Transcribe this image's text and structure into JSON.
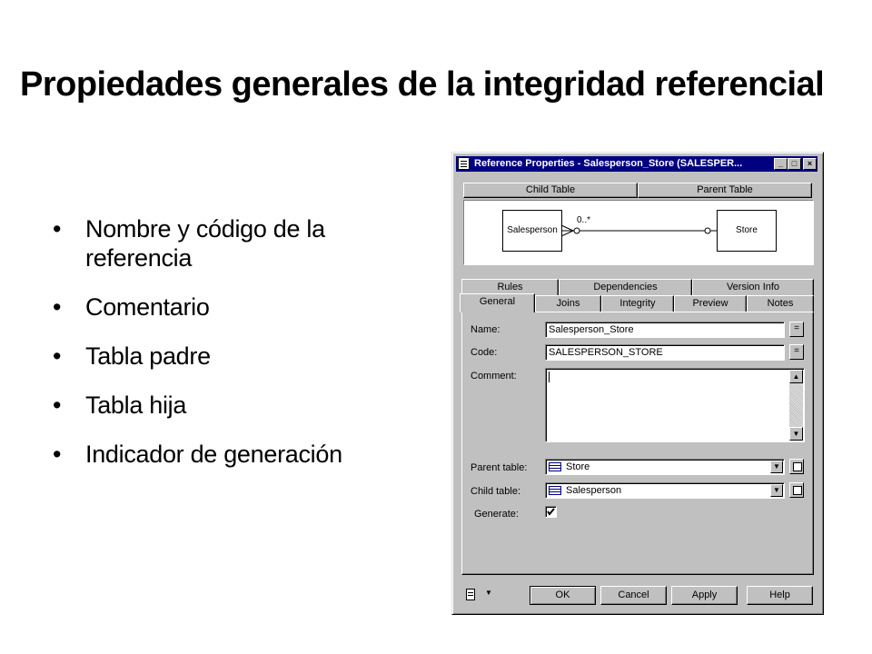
{
  "slide": {
    "title": "Propiedades generales de la integridad referencial",
    "bullets": [
      {
        "line1": "Nombre y código de la",
        "line2": "referencia"
      },
      {
        "line1": "Comentario",
        "line2": ""
      },
      {
        "line1": "Tabla padre",
        "line2": ""
      },
      {
        "line1": "Tabla hija",
        "line2": ""
      },
      {
        "line1": "Indicador de generación",
        "line2": ""
      }
    ],
    "bullet_glyph": "•"
  },
  "dialog": {
    "title": "Reference Properties - Salesperson_Store (SALESPER...",
    "title_buttons": [
      "_",
      "□",
      "×"
    ],
    "header_buttons": {
      "child_table": "Child Table",
      "parent_table": "Parent Table"
    },
    "diagram": {
      "child_entity": "Salesperson",
      "parent_entity": "Store",
      "cardinality": "0..*"
    },
    "tabs_back": [
      "Rules",
      "Dependencies",
      "Version Info"
    ],
    "tabs_front": [
      "General",
      "Joins",
      "Integrity",
      "Preview",
      "Notes"
    ],
    "active_tab": "General",
    "form": {
      "name_label": "Name:",
      "name_value": "Salesperson_Store",
      "code_label": "Code:",
      "code_value": "SALESPERSON_STORE",
      "equals_glyph": "=",
      "comment_label": "Comment:",
      "comment_value": "",
      "parent_table_label": "Parent table:",
      "parent_table_value": "Store",
      "child_table_label": "Child table:",
      "child_table_value": "Salesperson",
      "generate_label": "Generate:",
      "generate_checked": true
    },
    "footer": {
      "ok": "OK",
      "cancel": "Cancel",
      "apply": "Apply",
      "help": "Help"
    },
    "icons": [
      "app-icon",
      "table-icon",
      "properties-icon",
      "dropdown-arrow-icon",
      "scroll-up-icon",
      "scroll-down-icon",
      "checkmark-icon",
      "list-menu-icon"
    ],
    "colors": {
      "titlebar": "#000080",
      "face": "#c0c0c0"
    }
  }
}
